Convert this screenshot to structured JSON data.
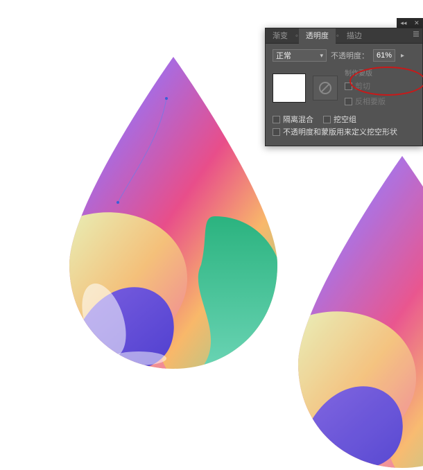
{
  "tabs": {
    "gradient": "渐变",
    "transparency": "透明度",
    "stroke": "描边"
  },
  "blend_mode": {
    "selected": "正常"
  },
  "opacity": {
    "label": "不透明度：",
    "value": "61%"
  },
  "mask": {
    "make_mask": "制作要版",
    "clip": "剪切",
    "invert": "反相要版"
  },
  "checks": {
    "isolate": "隔离混合",
    "knockout": "挖空组",
    "longopt": "不透明度和蒙版用来定义挖空形状"
  },
  "colors": {
    "highlight": "#c81919"
  }
}
